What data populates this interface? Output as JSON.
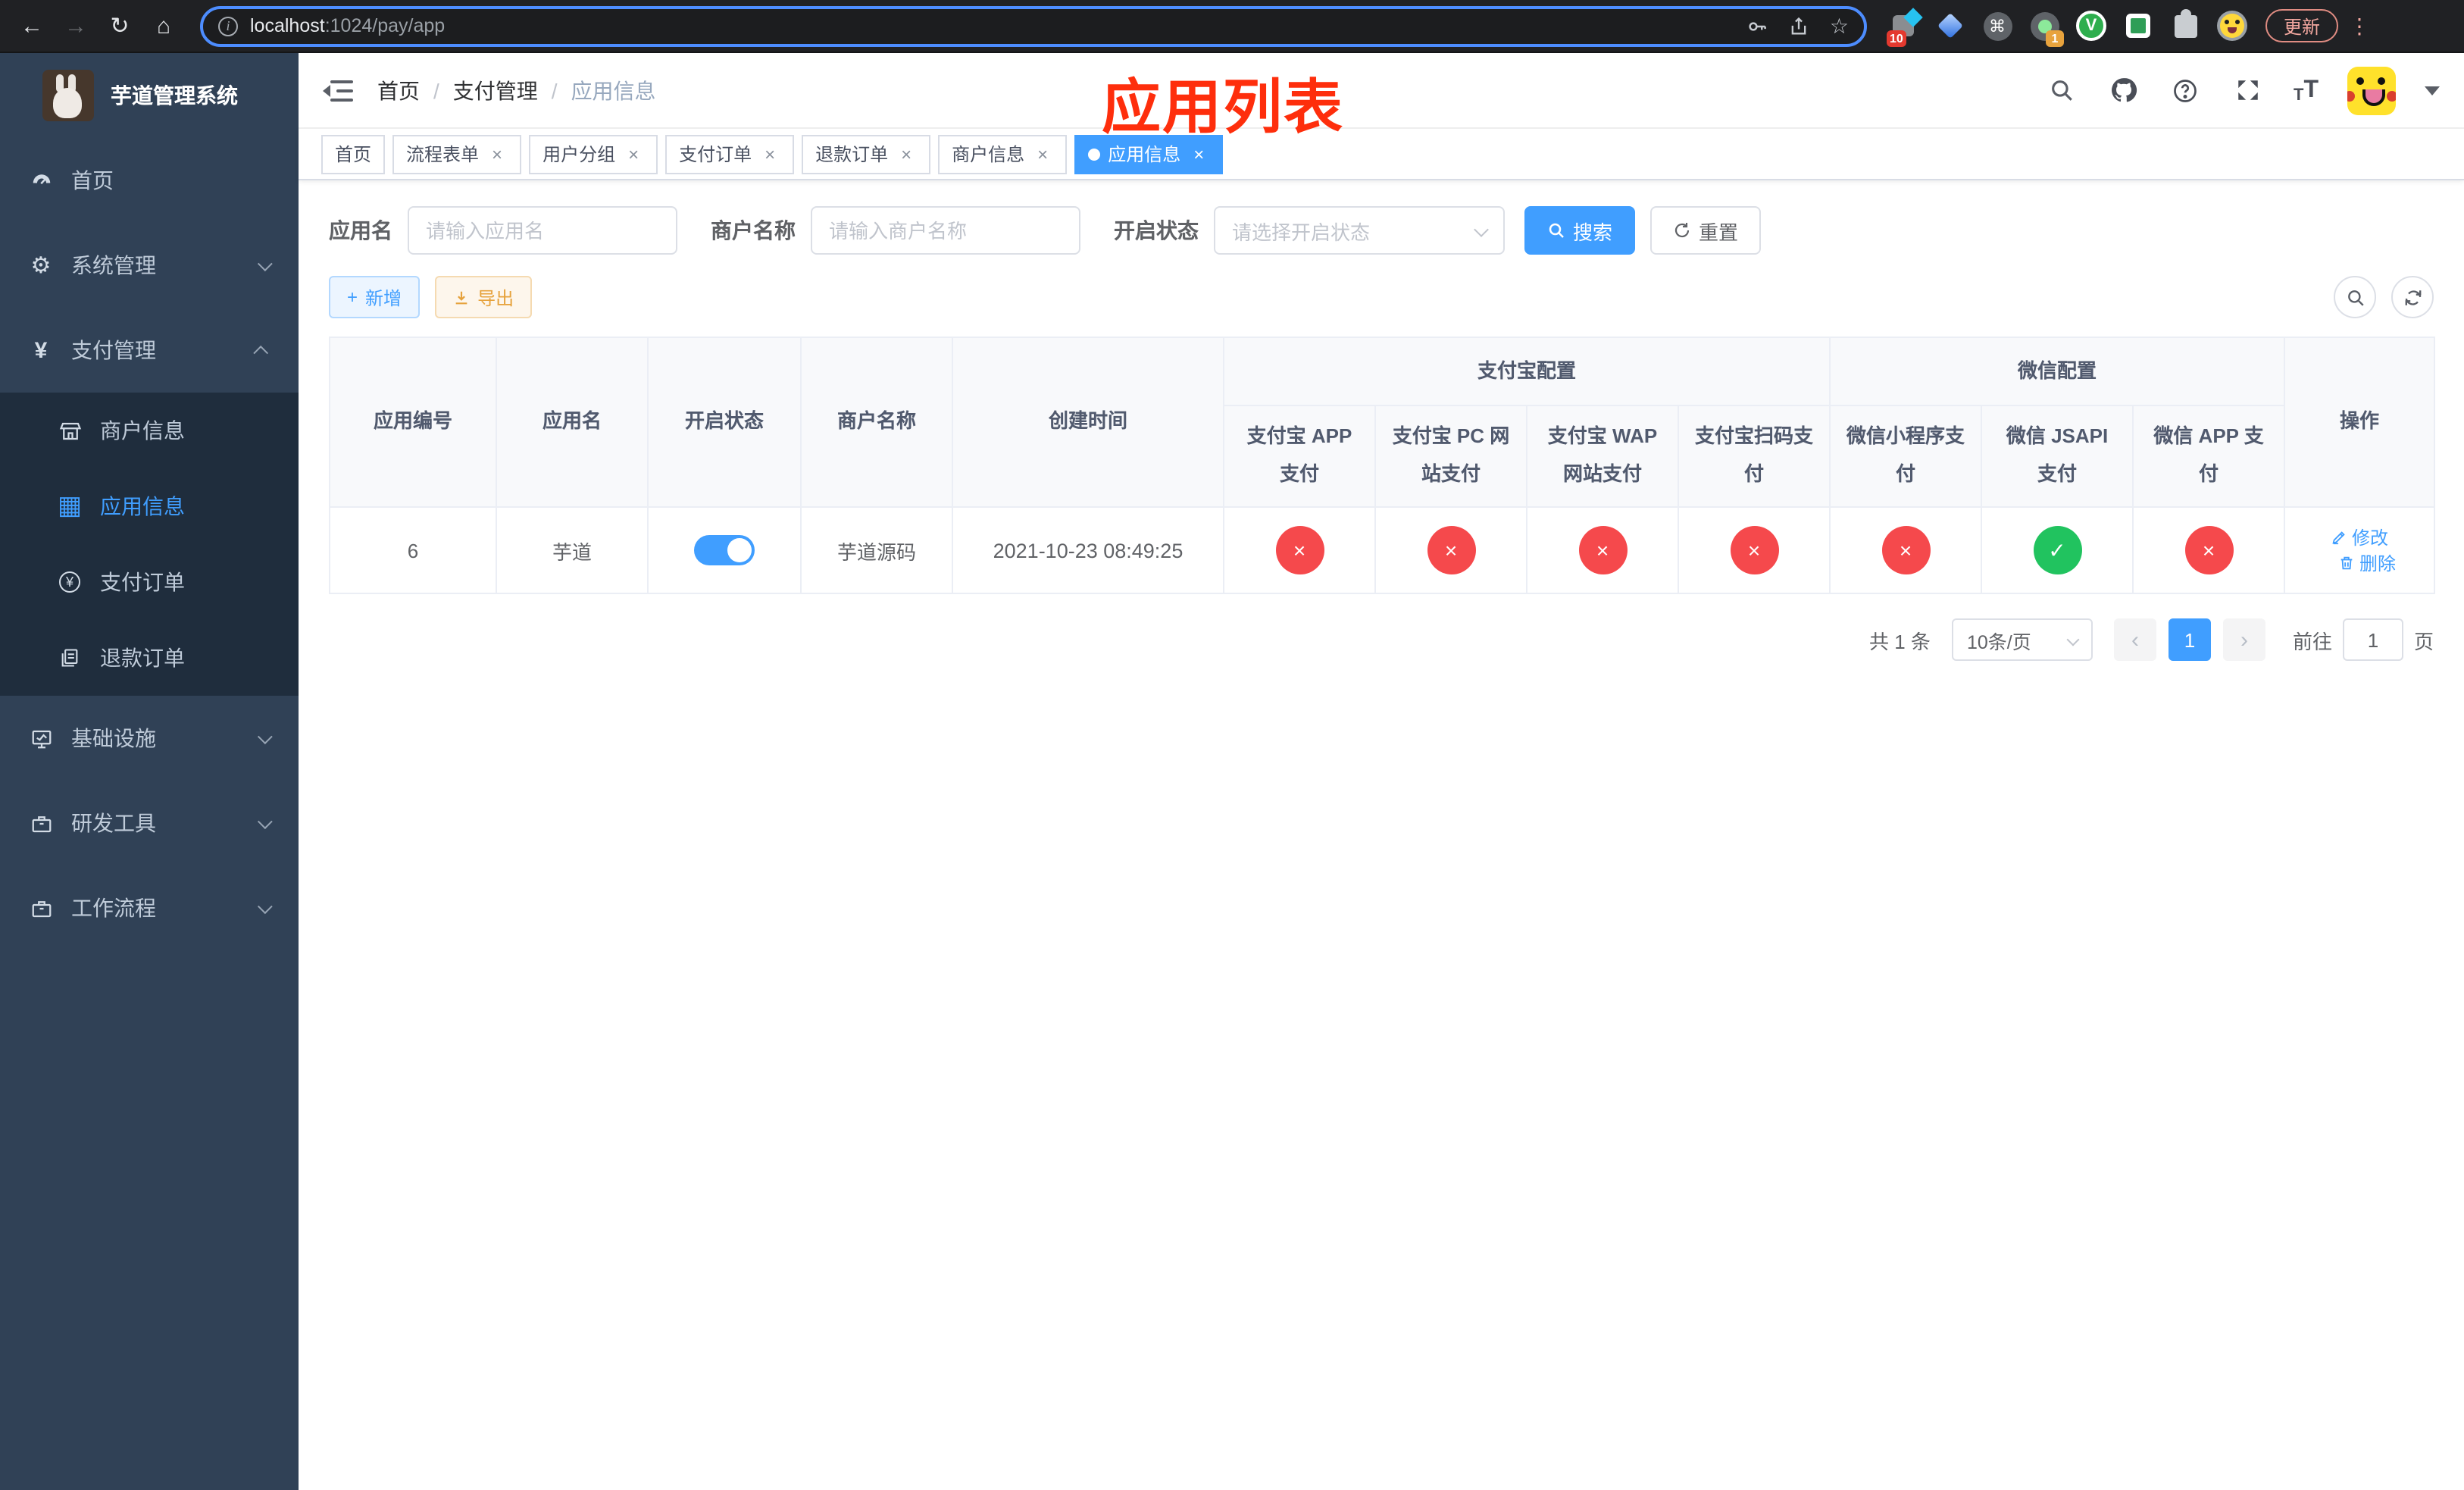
{
  "browser": {
    "url_host": "localhost",
    "url_rest": ":1024/pay/app",
    "update_button": "更新",
    "ext_badge_10": "10",
    "ext_badge_1": "1",
    "ext_v_label": "V"
  },
  "icons": {
    "back": "←",
    "forward": "→",
    "reload": "↻",
    "home": "⌂",
    "info": "i",
    "star": "☆",
    "command": "⌘",
    "kebab": "⋮",
    "close": "×",
    "plus": "+",
    "check": "✓",
    "cross": "×",
    "prev": "‹",
    "next": "›",
    "t_small": "T",
    "t_big": "T",
    "help": "?",
    "yen": "¥",
    "grid": "▦",
    "gear": "⚙"
  },
  "sidebar": {
    "title": "芋道管理系统",
    "items": [
      {
        "label": "首页"
      },
      {
        "label": "系统管理"
      },
      {
        "label": "支付管理"
      },
      {
        "label": "商户信息"
      },
      {
        "label": "应用信息"
      },
      {
        "label": "支付订单"
      },
      {
        "label": "退款订单"
      },
      {
        "label": "基础设施"
      },
      {
        "label": "研发工具"
      },
      {
        "label": "工作流程"
      }
    ]
  },
  "navbar": {
    "breadcrumb": [
      "首页",
      "支付管理",
      "应用信息"
    ]
  },
  "annotation": "应用列表",
  "tabs": [
    {
      "label": "首页"
    },
    {
      "label": "流程表单"
    },
    {
      "label": "用户分组"
    },
    {
      "label": "支付订单"
    },
    {
      "label": "退款订单"
    },
    {
      "label": "商户信息"
    },
    {
      "label": "应用信息"
    }
  ],
  "filters": {
    "app_name_label": "应用名",
    "app_name_placeholder": "请输入应用名",
    "merchant_label": "商户名称",
    "merchant_placeholder": "请输入商户名称",
    "status_label": "开启状态",
    "status_placeholder": "请选择开启状态",
    "search_button": "搜索",
    "reset_button": "重置"
  },
  "toolbar": {
    "add_button": "新增",
    "export_button": "导出"
  },
  "table": {
    "columns_left": [
      "应用编号",
      "应用名",
      "开启状态",
      "商户名称",
      "创建时间"
    ],
    "group_alipay": "支付宝配置",
    "group_wechat": "微信配置",
    "sub_columns": [
      "支付宝 APP 支付",
      "支付宝 PC 网站支付",
      "支付宝 WAP 网站支付",
      "支付宝扫码支付",
      "微信小程序支付",
      "微信 JSAPI 支付",
      "微信 APP 支付"
    ],
    "op_column": "操作",
    "row": {
      "id": "6",
      "name": "芋道",
      "enabled": true,
      "merchant": "芋道源码",
      "created": "2021-10-23 08:49:25",
      "statuses": [
        false,
        false,
        false,
        false,
        false,
        true,
        false
      ],
      "edit": "修改",
      "delete": "删除"
    }
  },
  "pagination": {
    "total": "共 1 条",
    "page_size": "10条/页",
    "current_page": "1",
    "goto_label": "前往",
    "goto_value": "1",
    "page_suffix": "页"
  },
  "colors": {
    "primary": "#409eff",
    "success": "#21c35f",
    "danger": "#f5494c",
    "sidebar_bg": "#304156",
    "submenu_bg": "#1f2d3d"
  }
}
